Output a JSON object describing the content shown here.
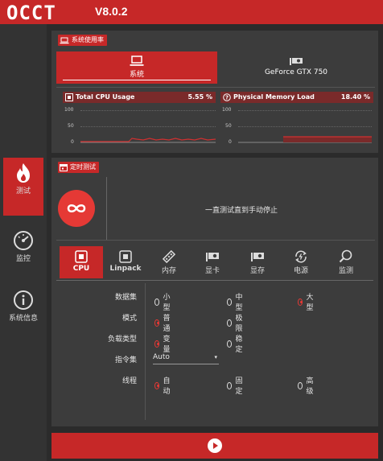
{
  "app": {
    "logo": "OCCT",
    "version": "V8.0.2"
  },
  "sidebar": {
    "items": [
      {
        "label": "测试"
      },
      {
        "label": "监控"
      },
      {
        "label": "系统信息"
      }
    ]
  },
  "usage_panel": {
    "title": "系统使用率",
    "tabs": [
      {
        "label": "系统"
      },
      {
        "label": "GeForce GTX 750"
      }
    ],
    "cpu": {
      "label": "Total CPU Usage",
      "value": "5.55 %",
      "ticks": [
        "100",
        "50",
        "0"
      ]
    },
    "memory": {
      "label": "Physical Memory Load",
      "value": "18.40 %",
      "ticks": [
        "100",
        "50",
        "0"
      ]
    }
  },
  "test_panel": {
    "title": "定时测试",
    "mode_text": "一直测试直到手动停止",
    "tabs": [
      {
        "label": "CPU"
      },
      {
        "label": "Linpack"
      },
      {
        "label": "内存"
      },
      {
        "label": "显卡"
      },
      {
        "label": "显存"
      },
      {
        "label": "电源"
      },
      {
        "label": "监测"
      }
    ],
    "settings": {
      "dataset": {
        "label": "数据集",
        "options": [
          "小型",
          "中型",
          "大型"
        ]
      },
      "mode": {
        "label": "模式",
        "options": [
          "普通",
          "极限"
        ]
      },
      "load_type": {
        "label": "负载类型",
        "options": [
          "变量",
          "稳定"
        ]
      },
      "instruction_set": {
        "label": "指令集",
        "value": "Auto"
      },
      "threads": {
        "label": "线程",
        "options": [
          "自动",
          "固定",
          "高级"
        ]
      }
    }
  },
  "colors": {
    "accent": "#c62828",
    "background": "#2b2b2b",
    "panel": "#3c3c3c"
  }
}
